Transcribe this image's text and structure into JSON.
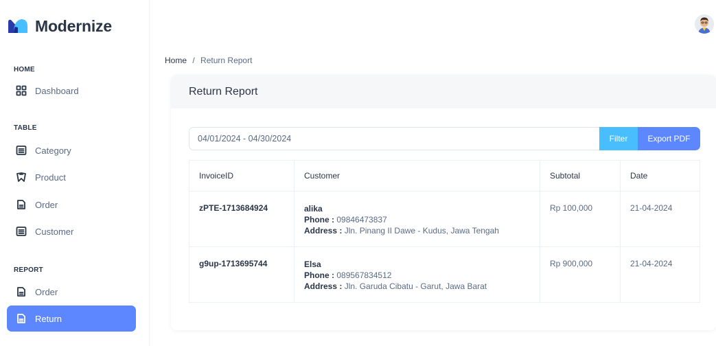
{
  "brand": {
    "name": "Modernize",
    "primary_color": "#5d87ff",
    "secondary_color": "#49beff"
  },
  "sidebar": {
    "sections": [
      {
        "title": "HOME",
        "items": [
          {
            "label": "Dashboard",
            "icon": "dashboard-icon"
          }
        ]
      },
      {
        "title": "TABLE",
        "items": [
          {
            "label": "Category",
            "icon": "list-icon"
          },
          {
            "label": "Product",
            "icon": "product-icon"
          },
          {
            "label": "Order",
            "icon": "file-icon"
          },
          {
            "label": "Customer",
            "icon": "list-icon"
          }
        ]
      },
      {
        "title": "REPORT",
        "items": [
          {
            "label": "Order",
            "icon": "file-icon"
          },
          {
            "label": "Return",
            "icon": "file-icon",
            "active": true
          }
        ]
      }
    ]
  },
  "breadcrumb": {
    "home": "Home",
    "separator": "/",
    "current": "Return Report"
  },
  "card": {
    "title": "Return Report"
  },
  "filter": {
    "date_range": "04/01/2024 - 04/30/2024",
    "filter_label": "Filter",
    "export_label": "Export PDF"
  },
  "table": {
    "headers": [
      "InvoiceID",
      "Customer",
      "Subtotal",
      "Date"
    ],
    "rows": [
      {
        "invoice": "zPTE-1713684924",
        "customer": "alika",
        "phone_label": "Phone :",
        "phone": "09846473837",
        "address_label": "Address :",
        "address": "Jln. Pinang II Dawe - Kudus, Jawa Tengah",
        "subtotal": "Rp 100,000",
        "date": "21-04-2024"
      },
      {
        "invoice": "g9up-1713695744",
        "customer": "Elsa",
        "phone_label": "Phone :",
        "phone": "089567834512",
        "address_label": "Address :",
        "address": "Jln. Garuda Cibatu - Garut, Jawa Barat",
        "subtotal": "Rp 900,000",
        "date": "21-04-2024"
      }
    ]
  }
}
